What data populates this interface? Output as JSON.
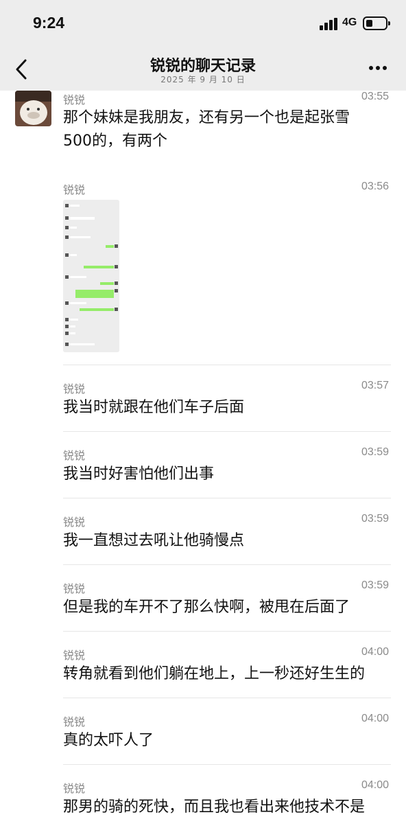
{
  "status_bar": {
    "time": "9:24",
    "network": "4G",
    "battery_level": 0.35
  },
  "header": {
    "title": "锐锐的聊天记录",
    "date": "2025 年 9 月 10 日"
  },
  "messages": [
    {
      "sender": "锐锐",
      "time": "03:55",
      "lines": [
        "那个妹妹是我朋友，还有另一个也是起张雪",
        "500的，有两个"
      ]
    },
    {
      "sender": "锐锐",
      "time": "03:56",
      "image": "chat-screenshot-thumbnail"
    },
    {
      "sender": "锐锐",
      "time": "03:57",
      "lines": [
        "我当时就跟在他们车子后面"
      ]
    },
    {
      "sender": "锐锐",
      "time": "03:59",
      "lines": [
        "我当时好害怕他们出事"
      ]
    },
    {
      "sender": "锐锐",
      "time": "03:59",
      "lines": [
        "我一直想过去吼让他骑慢点"
      ]
    },
    {
      "sender": "锐锐",
      "time": "03:59",
      "lines": [
        "但是我的车开不了那么快啊，被甩在后面了"
      ]
    },
    {
      "sender": "锐锐",
      "time": "04:00",
      "lines": [
        "转角就看到他们躺在地上，上一秒还好生生的"
      ]
    },
    {
      "sender": "锐锐",
      "time": "04:00",
      "lines": [
        "真的太吓人了"
      ]
    },
    {
      "sender": "锐锐",
      "time": "04:00",
      "lines": [
        "那男的骑的死快，而且我也看出来他技术不是"
      ]
    }
  ]
}
